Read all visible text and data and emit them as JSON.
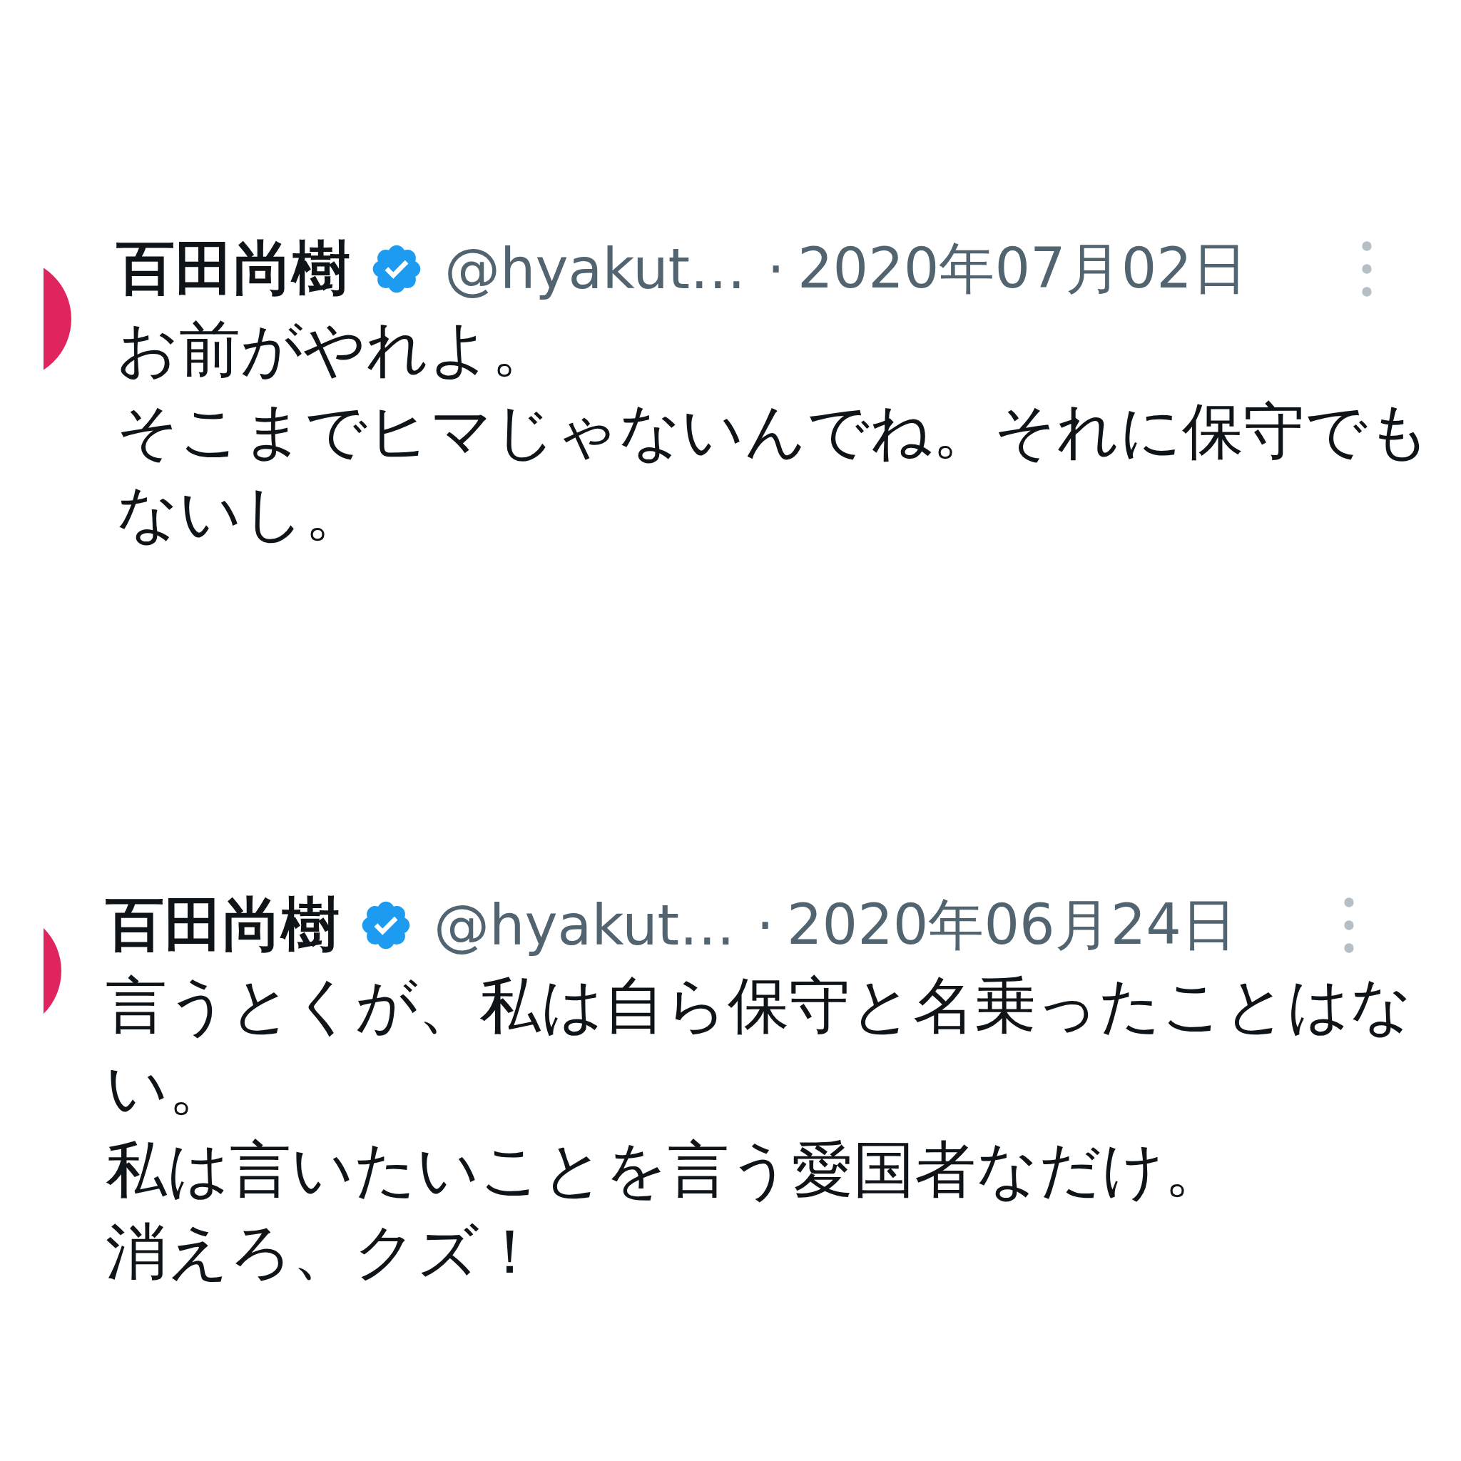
{
  "tweets": [
    {
      "name": "百田尚樹",
      "verified": true,
      "handle": "@hyakut…",
      "separator": "·",
      "date": "2020年07月02日",
      "lines": [
        "お前がやれよ。",
        "そこまでヒマじゃないんでね。それに保守でも",
        "ないし。"
      ]
    },
    {
      "name": "百田尚樹",
      "verified": true,
      "handle": "@hyakut…",
      "separator": "·",
      "date": "2020年06月24日",
      "lines": [
        "言うとくが、私は自ら保守と名乗ったことはな",
        "い。",
        "私は言いたいことを言う愛国者なだけ。",
        "消えろ、クズ！"
      ]
    }
  ]
}
